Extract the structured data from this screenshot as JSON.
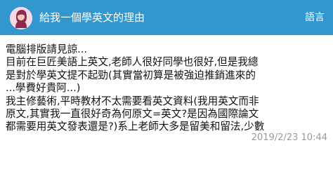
{
  "header": {
    "title": "給我一個學英文的理由",
    "lang_label": "語言",
    "accent_color": "#3397cf",
    "avatar_icon": "female-avatar-icon"
  },
  "post": {
    "lines": [
      "電腦排版請見諒...",
      "目前在巨匠美語上英文,老師人很好同學也很好,但是我總",
      "是對於學英文提不起勁(其實當初算是被強迫推銷進來的",
      "...學費好貴阿...)",
      "我主修藝術,平時教材不太需要看英文資料(我用英文而非",
      "原文,其實我一直很好奇為何原文=英文?是因為國際論文",
      "都需要用英文發表還是?)系上老師大多是留美和留法,少數"
    ],
    "date": "2019/2/23 10:44"
  }
}
